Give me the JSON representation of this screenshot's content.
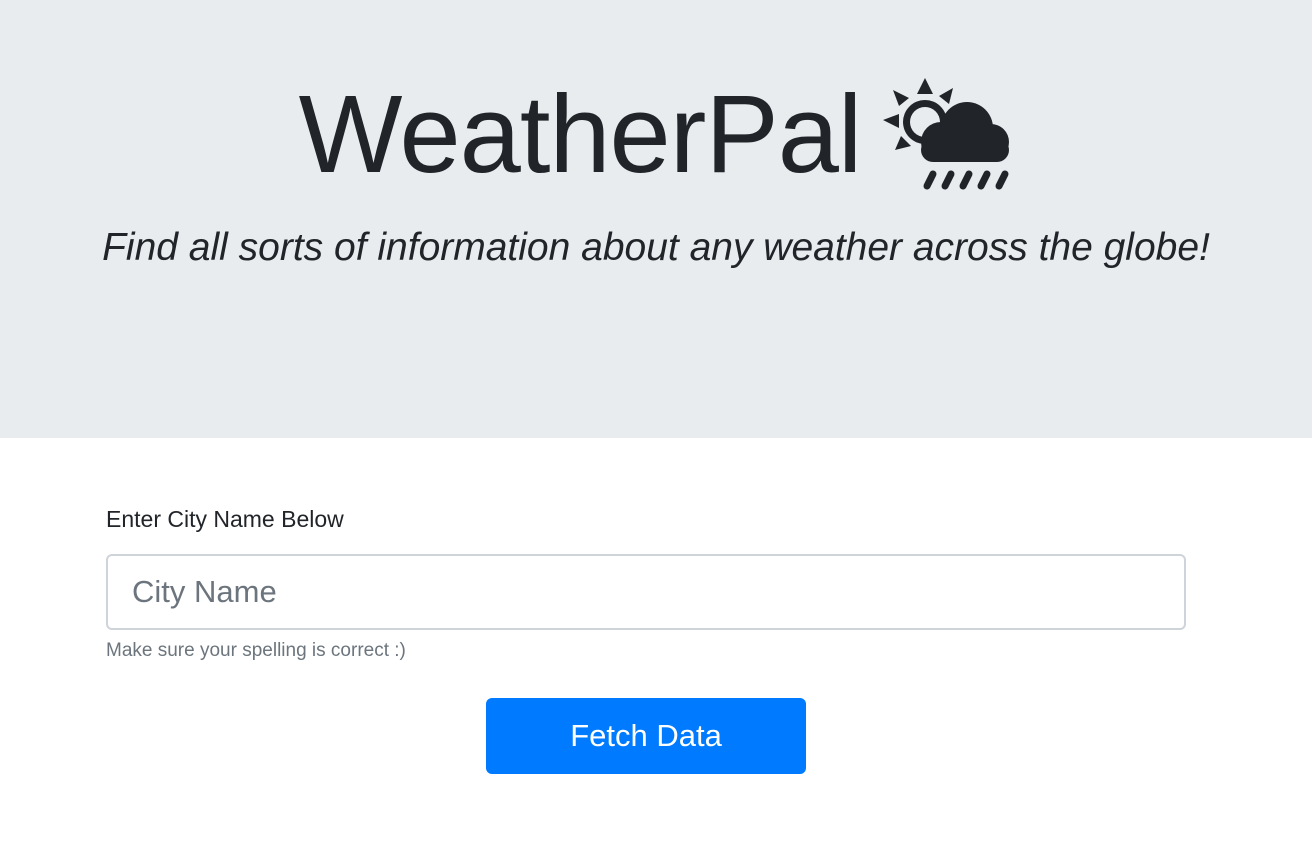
{
  "header": {
    "title": "WeatherPal",
    "icon": "sun-behind-rain-cloud-icon",
    "tagline": "Find all sorts of information about any weather across the globe!"
  },
  "form": {
    "label": "Enter City Name Below",
    "input_placeholder": "City Name",
    "input_value": "",
    "help_text": "Make sure your spelling is correct :)",
    "submit_label": "Fetch Data"
  },
  "colors": {
    "jumbotron_bg": "#e9ecef",
    "primary": "#007bff",
    "text": "#212529",
    "muted": "#6c757d"
  }
}
